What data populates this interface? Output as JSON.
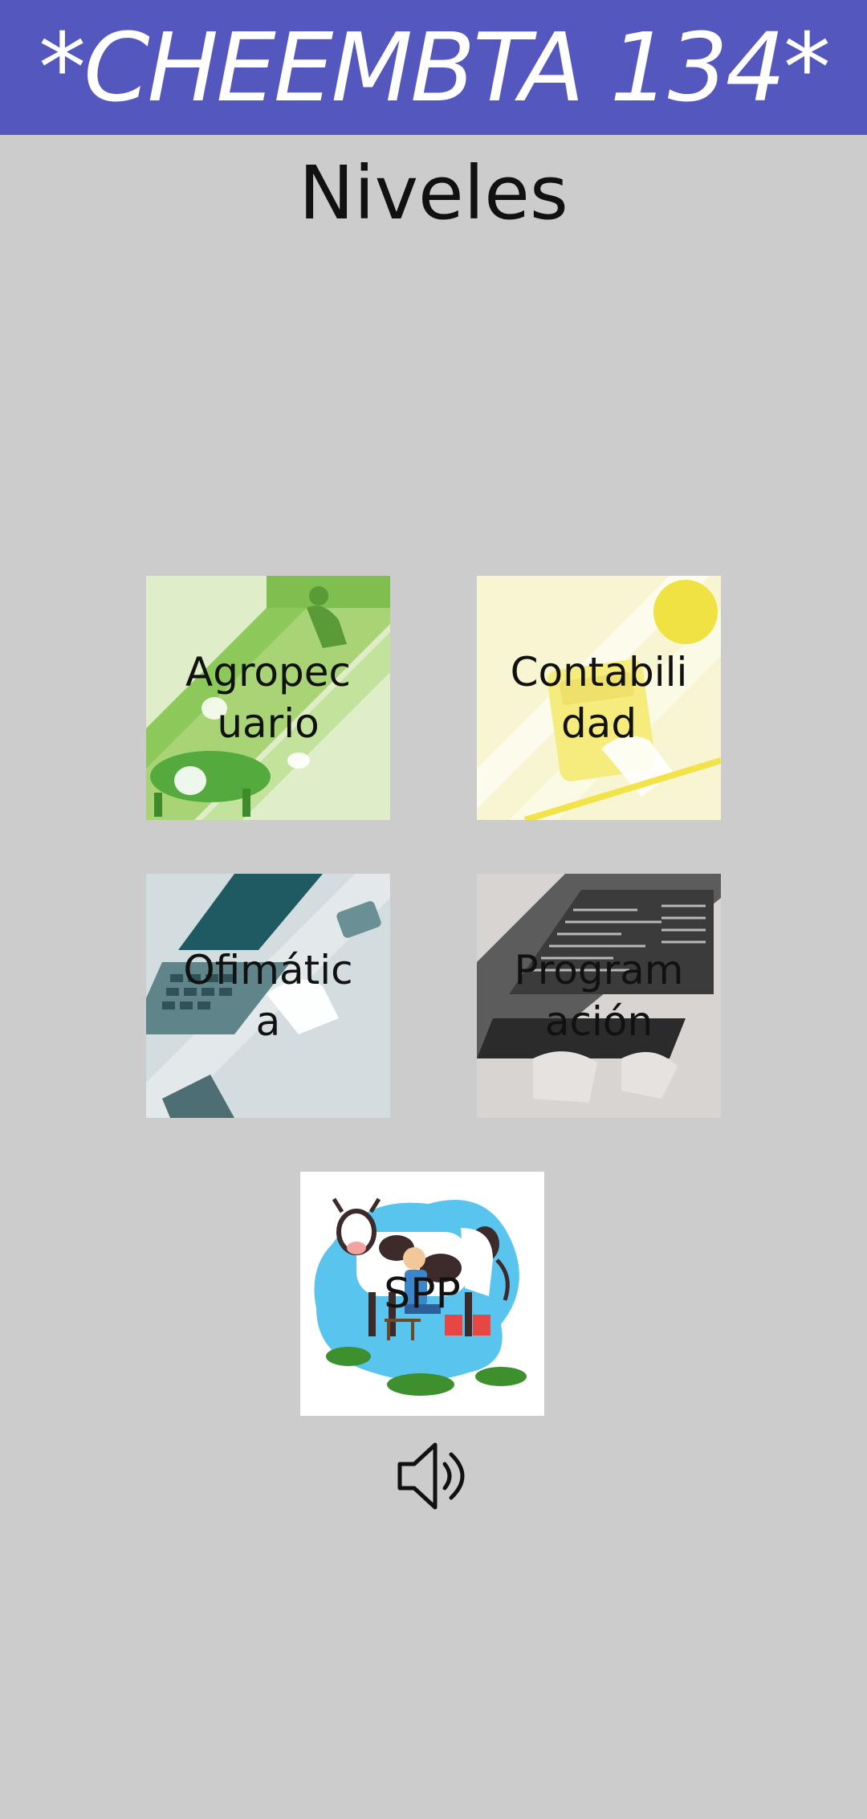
{
  "header": {
    "title": "*CHEEMBTA 134*"
  },
  "page": {
    "title": "Niveles"
  },
  "levels": [
    {
      "label": "Agropecuario",
      "display": "Agropec uario",
      "icon": "agriculture-image"
    },
    {
      "label": "Contabilidad",
      "display": "Contabili dad",
      "icon": "accounting-image"
    },
    {
      "label": "Ofimática",
      "display": "Ofimátic a",
      "icon": "office-image"
    },
    {
      "label": "Programación",
      "display": "Program ación",
      "icon": "programming-image"
    },
    {
      "label": "SPP",
      "display": "SPP",
      "icon": "cow-milking-image"
    }
  ],
  "sound": {
    "icon": "speaker-icon"
  },
  "colors": {
    "header_bg": "#5457bd",
    "page_bg": "#cccccc",
    "agro_bg": "#dfedc9",
    "conta_bg": "#f8f6d2",
    "ofi_bg": "#d3dddf",
    "prog_bg": "#d7d4d2"
  }
}
